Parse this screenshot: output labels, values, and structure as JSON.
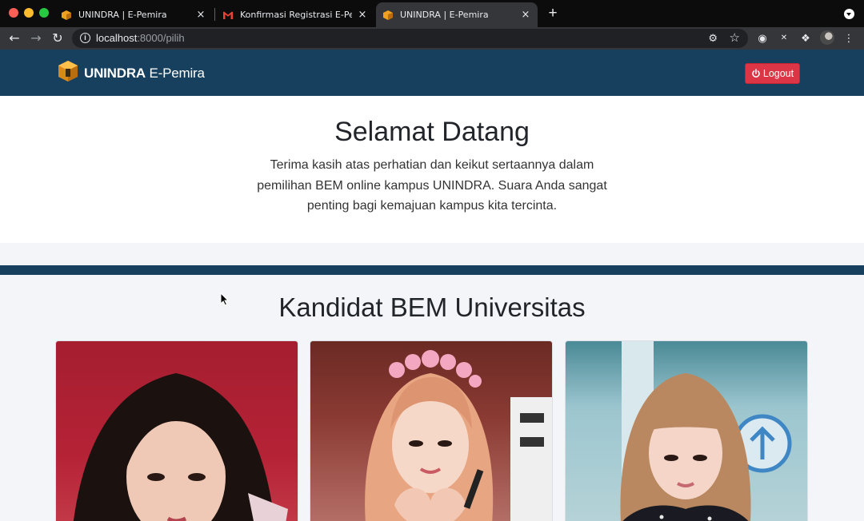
{
  "browser": {
    "tabs": [
      {
        "title": "UNINDRA | E-Pemira",
        "close": "×"
      },
      {
        "title": "Konfirmasi Registrasi E-Pemira",
        "close": "×"
      },
      {
        "title": "UNINDRA | E-Pemira",
        "close": "×"
      }
    ],
    "new_tab": "+",
    "url_host": "localhost",
    "url_path": ":8000/pilih"
  },
  "navbar": {
    "brand_bold": "UNINDRA",
    "brand_rest": " E-Pemira",
    "logout_label": "Logout"
  },
  "welcome": {
    "title": "Selamat Datang",
    "text": "Terima kasih atas perhatian dan keikut sertaannya dalam pemilihan BEM online kampus UNINDRA. Suara Anda sangat penting bagi kemajuan kampus kita tercinta."
  },
  "candidates": {
    "heading": "Kandidat BEM Universitas",
    "items": [
      {
        "photo": "candidate-photo-1"
      },
      {
        "photo": "candidate-photo-2"
      },
      {
        "photo": "candidate-photo-3"
      }
    ]
  },
  "colors": {
    "navbar": "#17405e",
    "logout": "#dc3545",
    "accent_orange": "#f0a020"
  }
}
